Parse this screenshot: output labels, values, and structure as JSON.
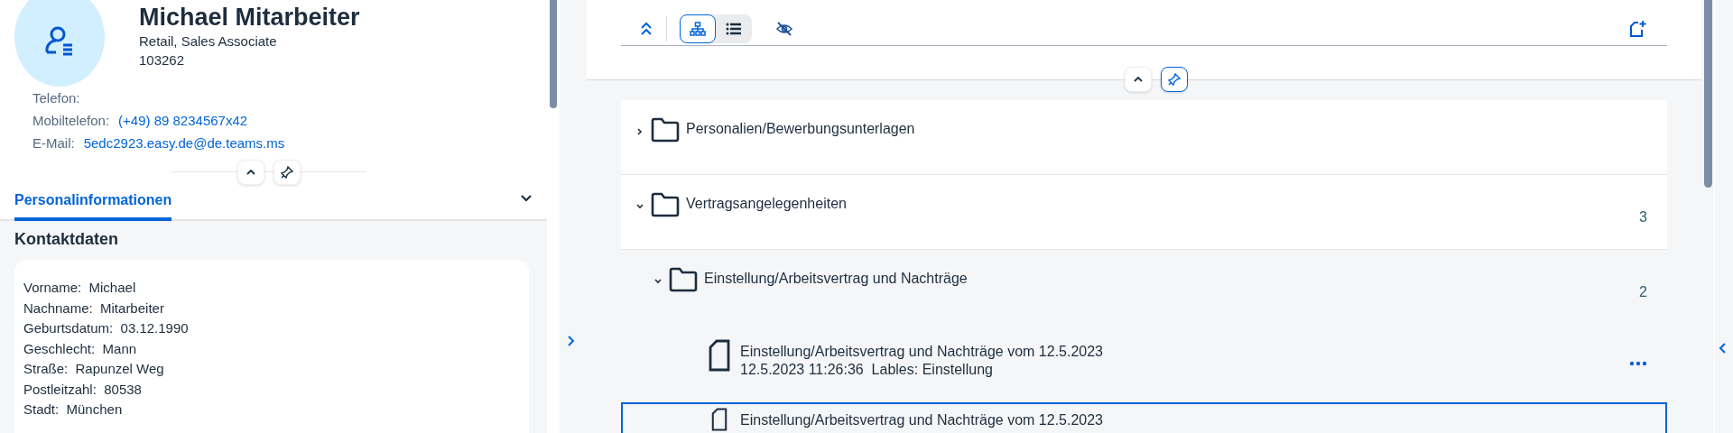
{
  "profile": {
    "name": "Michael Mitarbeiter",
    "lines": [
      "Retail, Sales Associate",
      "103262"
    ],
    "contacts": [
      {
        "label": "Telefon:",
        "kind": "text"
      },
      {
        "label": "Mobiltelefon:",
        "value": "(+49) 89 8234567x42",
        "kind": "link"
      },
      {
        "label": "E-Mail:",
        "value": "5edc2923.easy.de@de.teams.ms",
        "kind": "link"
      }
    ]
  },
  "tabs": [
    {
      "label": "Personalinformationen",
      "selected": true
    }
  ],
  "section": {
    "title": "Kontaktdaten",
    "fields": [
      {
        "label": "Vorname:",
        "value": "Michael"
      },
      {
        "label": "Nachname:",
        "value": "Mitarbeiter"
      },
      {
        "label": "Geburtsdatum:",
        "value": "03.12.1990"
      },
      {
        "label": "Geschlecht:",
        "value": "Mann"
      },
      {
        "label": "Straße:",
        "value": "Rapunzel Weg"
      },
      {
        "label": "Postleitzahl:",
        "value": "80538"
      },
      {
        "label": "Stadt:",
        "value": "München"
      }
    ]
  },
  "toolbar": {
    "views": [
      {
        "kind": "hierarchy",
        "selected": true
      },
      {
        "kind": "list",
        "selected": false
      }
    ]
  },
  "tree": [
    {
      "kind": "folder",
      "title": "Personalien/Bewerbungsunterlagen",
      "expanded": false,
      "selected": false
    },
    {
      "kind": "folder",
      "title": "Vertragsangelegenheiten",
      "expanded": true,
      "count": "3",
      "selected": false,
      "children": [
        {
          "kind": "folder",
          "title": "Einstellung/Arbeitsvertrag und Nachträge",
          "expanded": true,
          "count": "2",
          "selected": false,
          "children": [
            {
              "kind": "document",
              "title": "Einstellung/Arbeitsvertrag und Nachträge vom 12.5.2023",
              "meta": "12.5.2023 11:26:36  Lables: Einstellung",
              "actions": true,
              "selected": false
            },
            {
              "kind": "document",
              "title": "Einstellung/Arbeitsvertrag und Nachträge vom 12.5.2023",
              "actions": false,
              "selected": true
            }
          ]
        }
      ]
    }
  ]
}
